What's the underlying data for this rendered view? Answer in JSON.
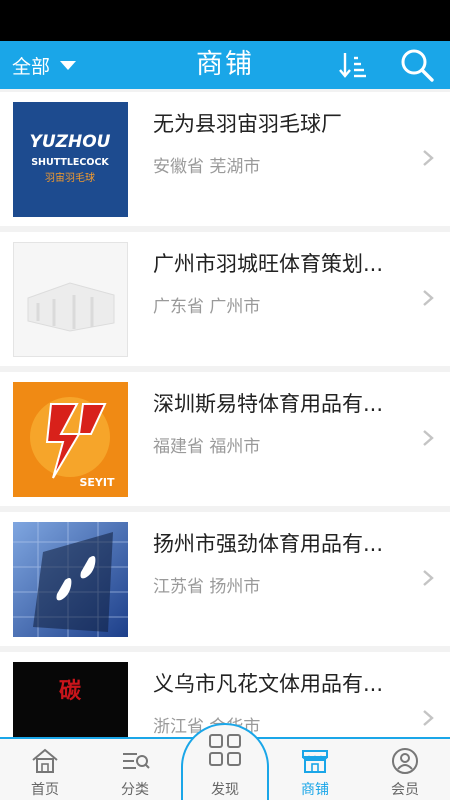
{
  "header": {
    "filter_label": "全部",
    "title": "商铺"
  },
  "shops": [
    {
      "name": "无为县羽宙羽毛球厂",
      "location": "安徽省 芜湖市",
      "logo_line1": "YUZHOU",
      "logo_line2": "SHUTTLECOCK",
      "logo_line3": "羽宙羽毛球"
    },
    {
      "name": "广州市羽城旺体育策划...",
      "location": "广东省 广州市"
    },
    {
      "name": "深圳斯易特体育用品有...",
      "location": "福建省 福州市",
      "logo_line1": "SEYIT"
    },
    {
      "name": "扬州市强劲体育用品有...",
      "location": "江苏省 扬州市"
    },
    {
      "name": "义乌市凡花文体用品有...",
      "location": "浙江省 金华市",
      "logo_line1": "碳"
    }
  ],
  "tabbar": {
    "items": [
      {
        "label": "首页",
        "icon": "home-icon"
      },
      {
        "label": "分类",
        "icon": "category-icon"
      },
      {
        "label": "发现",
        "icon": "discover-grid-icon"
      },
      {
        "label": "商铺",
        "icon": "shop-icon"
      },
      {
        "label": "会员",
        "icon": "member-icon"
      }
    ],
    "active": "商铺"
  },
  "colors": {
    "accent": "#1aa6e8",
    "text_primary": "#222222",
    "text_secondary": "#9a9a9a"
  }
}
